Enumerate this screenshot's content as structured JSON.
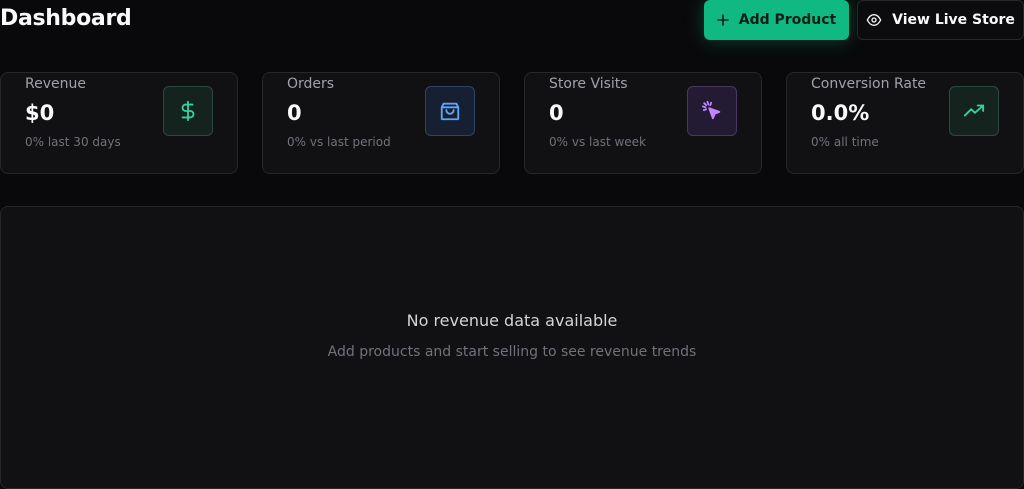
{
  "header": {
    "title": "Dashboard",
    "add_product_label": "Add Product",
    "view_store_label": "View Live Store"
  },
  "stats": [
    {
      "label": "Revenue",
      "value": "$0",
      "sub": "0% last 30 days",
      "icon": "dollar-icon",
      "color": "#34d399"
    },
    {
      "label": "Orders",
      "value": "0",
      "sub": "0% vs last period",
      "icon": "shopping-bag-icon",
      "color": "#60a5fa"
    },
    {
      "label": "Store Visits",
      "value": "0",
      "sub": "0% vs last week",
      "icon": "cursor-click-icon",
      "color": "#c084fc"
    },
    {
      "label": "Conversion Rate",
      "value": "0.0%",
      "sub": "0% all time",
      "icon": "trending-up-icon",
      "color": "#34d399"
    }
  ],
  "revenue_chart": {
    "empty_title": "No revenue data available",
    "empty_subtitle": "Add products and start selling to see revenue trends"
  },
  "colors": {
    "accent": "#10b981",
    "background": "#09090b",
    "card": "#111114",
    "border": "#27272a"
  }
}
